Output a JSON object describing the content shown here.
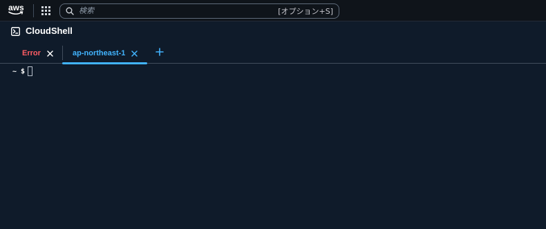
{
  "topbar": {
    "logo_text": "aws",
    "search_placeholder": "検索",
    "search_shortcut": "[オプション+S]",
    "logo_color": "#ff9900"
  },
  "header": {
    "title": "CloudShell"
  },
  "tabs": [
    {
      "label": "Error",
      "status": "error",
      "color": "#ff5d64"
    },
    {
      "label": "ap-northeast-1",
      "status": "active",
      "color": "#42b4ff"
    }
  ],
  "terminal": {
    "prompt": "~ $"
  },
  "icons": {
    "apps": "grid-icon",
    "search": "search-icon",
    "terminal": "terminal-icon",
    "close": "close-icon",
    "add": "plus-icon"
  }
}
